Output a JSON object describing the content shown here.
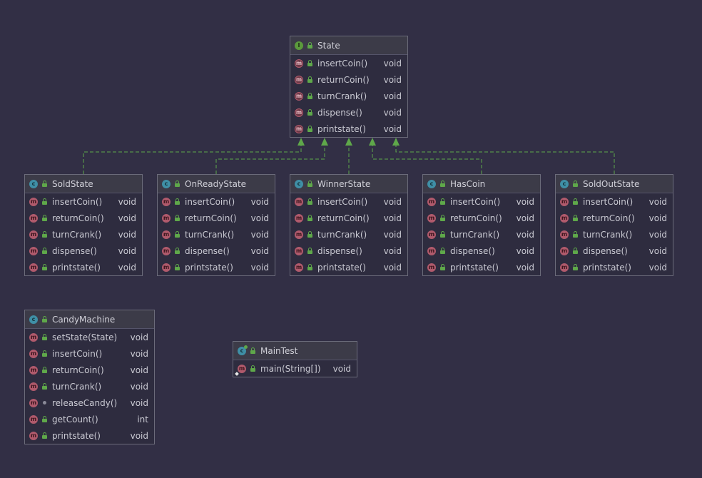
{
  "colors": {
    "background": "#322f45",
    "box_fill": "#2e2c3f",
    "box_border": "#6b6b7a",
    "header_fill": "#3c3b48",
    "interface_icon": "#5b9a3c",
    "class_icon": "#3f8fa6",
    "method_icon": "#b05a6c",
    "connector": "#5fa84a"
  },
  "icons": {
    "interface": "I",
    "class": "c",
    "method": "m",
    "abstract_method": "m"
  },
  "boxes": {
    "state": {
      "name": "State",
      "kind": "interface",
      "members": [
        {
          "name": "insertCoin()",
          "type": "void"
        },
        {
          "name": "returnCoin()",
          "type": "void"
        },
        {
          "name": "turnCrank()",
          "type": "void"
        },
        {
          "name": "dispense()",
          "type": "void"
        },
        {
          "name": "printstate()",
          "type": "void"
        }
      ]
    },
    "soldstate": {
      "name": "SoldState",
      "kind": "class",
      "members": [
        {
          "name": "insertCoin()",
          "type": "void"
        },
        {
          "name": "returnCoin()",
          "type": "void"
        },
        {
          "name": "turnCrank()",
          "type": "void"
        },
        {
          "name": "dispense()",
          "type": "void"
        },
        {
          "name": "printstate()",
          "type": "void"
        }
      ]
    },
    "onreadystate": {
      "name": "OnReadyState",
      "kind": "class",
      "members": [
        {
          "name": "insertCoin()",
          "type": "void"
        },
        {
          "name": "returnCoin()",
          "type": "void"
        },
        {
          "name": "turnCrank()",
          "type": "void"
        },
        {
          "name": "dispense()",
          "type": "void"
        },
        {
          "name": "printstate()",
          "type": "void"
        }
      ]
    },
    "winnerstate": {
      "name": "WinnerState",
      "kind": "class",
      "members": [
        {
          "name": "insertCoin()",
          "type": "void"
        },
        {
          "name": "returnCoin()",
          "type": "void"
        },
        {
          "name": "turnCrank()",
          "type": "void"
        },
        {
          "name": "dispense()",
          "type": "void"
        },
        {
          "name": "printstate()",
          "type": "void"
        }
      ]
    },
    "hascoin": {
      "name": "HasCoin",
      "kind": "class",
      "members": [
        {
          "name": "insertCoin()",
          "type": "void"
        },
        {
          "name": "returnCoin()",
          "type": "void"
        },
        {
          "name": "turnCrank()",
          "type": "void"
        },
        {
          "name": "dispense()",
          "type": "void"
        },
        {
          "name": "printstate()",
          "type": "void"
        }
      ]
    },
    "soldoutstate": {
      "name": "SoldOutState",
      "kind": "class",
      "members": [
        {
          "name": "insertCoin()",
          "type": "void"
        },
        {
          "name": "returnCoin()",
          "type": "void"
        },
        {
          "name": "turnCrank()",
          "type": "void"
        },
        {
          "name": "dispense()",
          "type": "void"
        },
        {
          "name": "printstate()",
          "type": "void"
        }
      ]
    },
    "candymachine": {
      "name": "CandyMachine",
      "kind": "class",
      "members": [
        {
          "name": "setState(State)",
          "type": "void"
        },
        {
          "name": "insertCoin()",
          "type": "void"
        },
        {
          "name": "returnCoin()",
          "type": "void"
        },
        {
          "name": "turnCrank()",
          "type": "void"
        },
        {
          "name": "releaseCandy()",
          "type": "void"
        },
        {
          "name": "getCount()",
          "type": "int"
        },
        {
          "name": "printstate()",
          "type": "void"
        }
      ]
    },
    "maintest": {
      "name": "MainTest",
      "kind": "class",
      "members": [
        {
          "name": "main(String[])",
          "type": "void"
        }
      ]
    }
  }
}
